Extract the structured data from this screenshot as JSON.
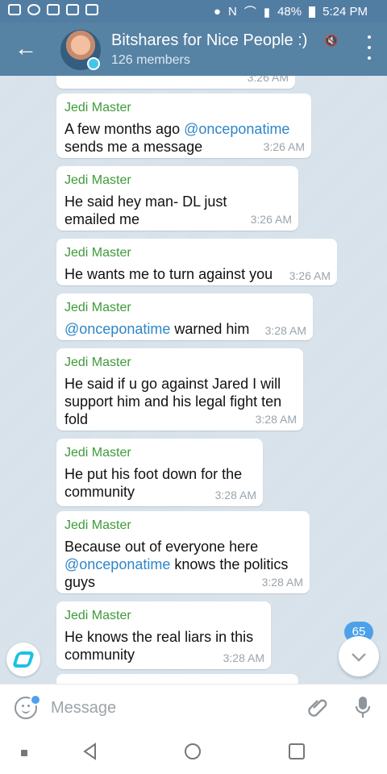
{
  "status_bar": {
    "battery": "48%",
    "time": "5:24 PM"
  },
  "header": {
    "title": "Bitshares for Nice People :)",
    "members": "126 members"
  },
  "top_partial_time": "3:26 AM",
  "messages": [
    {
      "sender": "Jedi Master",
      "pre": "A few months ago ",
      "link": "@onceponatime",
      "post": " sends me a message",
      "time": "3:26 AM"
    },
    {
      "sender": "Jedi Master",
      "pre": "He said hey man- DL just emailed me",
      "link": "",
      "post": "",
      "time": "3:26 AM"
    },
    {
      "sender": "Jedi Master",
      "pre": "He wants me to turn against you",
      "link": "",
      "post": "",
      "time": "3:26 AM"
    },
    {
      "sender": "Jedi Master",
      "pre": "",
      "link": "@onceponatime",
      "post": " warned him",
      "time": "3:28 AM"
    },
    {
      "sender": "Jedi Master",
      "pre": "He said if u go against Jared I will support him and his legal fight ten fold",
      "link": "",
      "post": "",
      "time": "3:28 AM"
    },
    {
      "sender": "Jedi Master",
      "pre": "He put his foot down for the community",
      "link": "",
      "post": "",
      "time": "3:28 AM"
    },
    {
      "sender": "Jedi Master",
      "pre": "Because out of everyone here ",
      "link": "@onceponatime",
      "post": " knows the politics guys",
      "time": "3:28 AM"
    },
    {
      "sender": "Jedi Master",
      "pre": "He knows the real liars in this community",
      "link": "",
      "post": "",
      "time": "3:28 AM"
    }
  ],
  "unread_badge": "65",
  "composer": {
    "placeholder": "Message"
  },
  "colors": {
    "header": "#5682a3",
    "sender": "#3d9b39",
    "link": "#2e86c8",
    "badge": "#4da1ea"
  }
}
